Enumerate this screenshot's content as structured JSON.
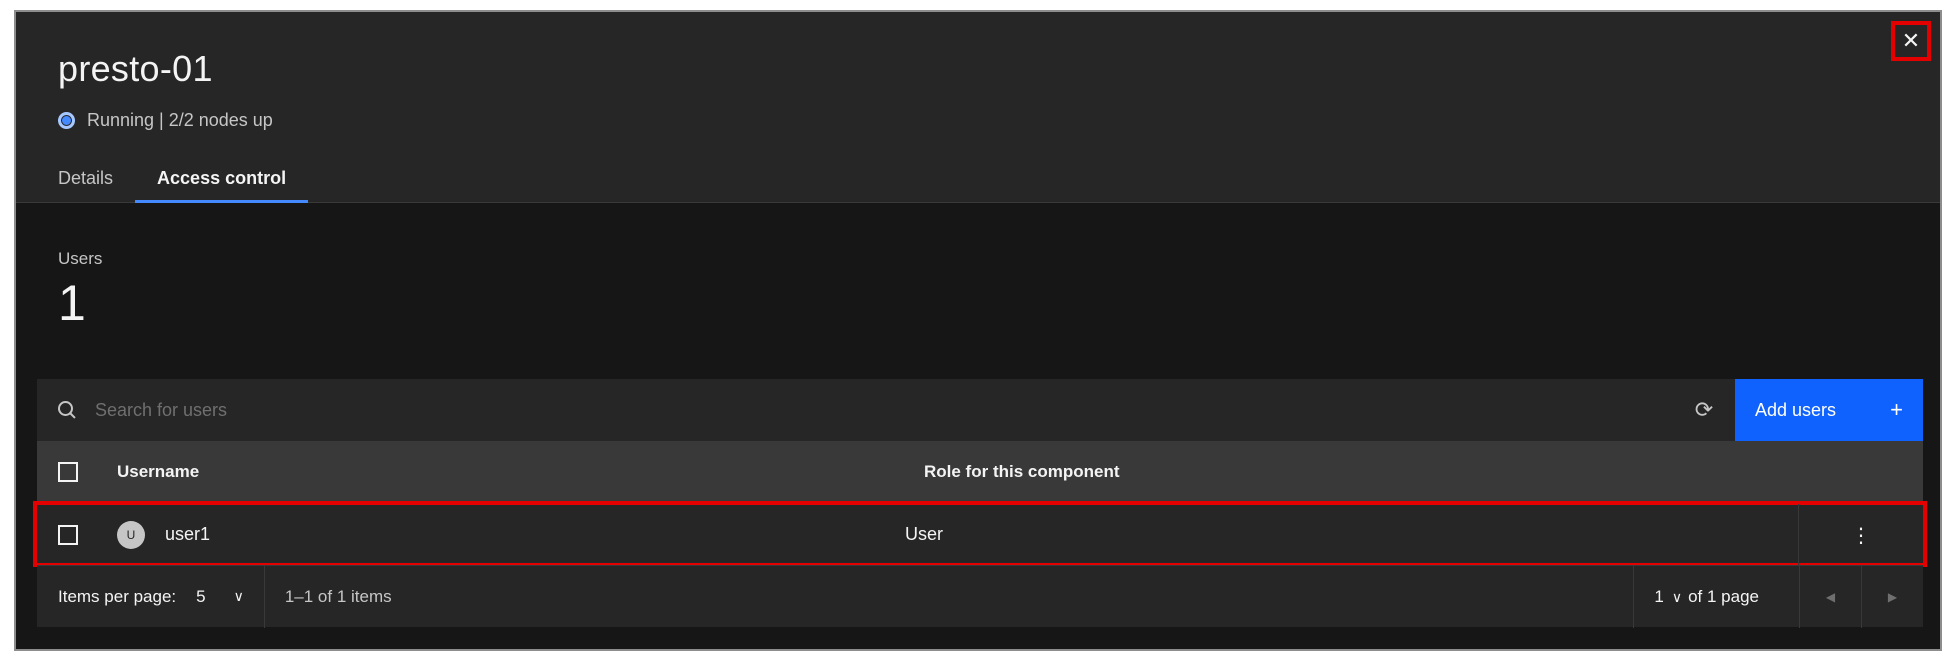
{
  "header": {
    "title": "presto-01",
    "status": "Running | 2/2 nodes up",
    "close_icon": "close-icon",
    "tabs": [
      {
        "label": "Details",
        "active": false
      },
      {
        "label": "Access control",
        "active": true
      }
    ]
  },
  "summary": {
    "users_label": "Users",
    "users_count": "1"
  },
  "toolbar": {
    "search_placeholder": "Search for users",
    "refresh_icon": "refresh-icon",
    "add_label": "Add users",
    "add_icon": "+"
  },
  "table": {
    "columns": [
      "Username",
      "Role for this component"
    ],
    "rows": [
      {
        "avatar": "U",
        "username": "user1",
        "role": "User",
        "menu_icon": "overflow-menu-icon"
      }
    ]
  },
  "pagination": {
    "items_per_page_label": "Items per page:",
    "items_per_page_value": "5",
    "range_text": "1–1 of 1 items",
    "page_value": "1",
    "of_pages_text": "of 1 page"
  },
  "colors": {
    "accent": "#0f62fe",
    "highlight": "#e50000",
    "status_dot": "#4589ff"
  }
}
